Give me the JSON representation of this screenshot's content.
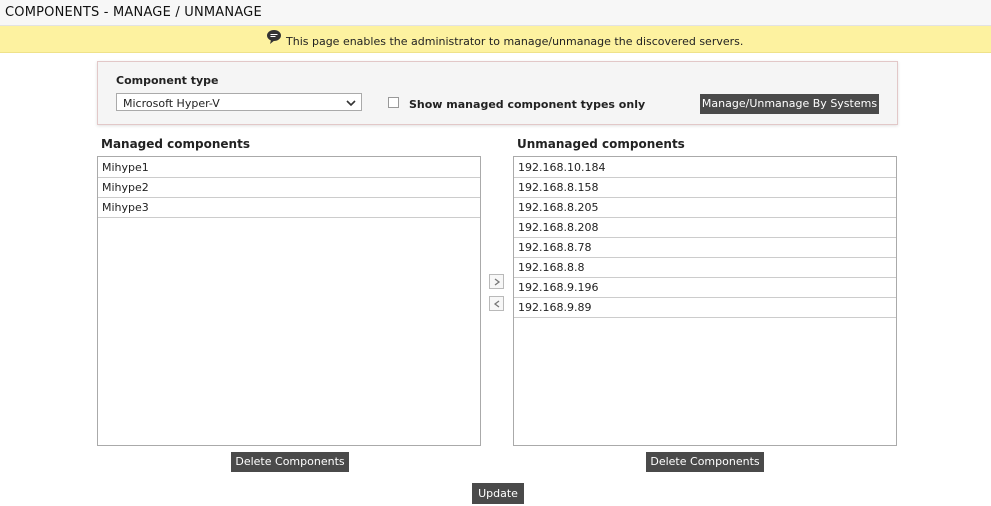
{
  "header": {
    "title": "COMPONENTS - MANAGE / UNMANAGE"
  },
  "info": {
    "icon": "speech-bubble-icon",
    "message": "This page enables the administrator to manage/unmanage the discovered servers."
  },
  "filter": {
    "component_type_label": "Component type",
    "component_type_value": "Microsoft Hyper-V",
    "checkbox_label": "Show managed component types only",
    "systems_button": "Manage/Unmanage By Systems"
  },
  "managed": {
    "heading": "Managed components",
    "items": [
      "Mihype1",
      "Mihype2",
      "Mihype3"
    ],
    "delete_button": "Delete Components"
  },
  "unmanaged": {
    "heading": "Unmanaged components",
    "items": [
      "192.168.10.184",
      "192.168.8.158",
      "192.168.8.205",
      "192.168.8.208",
      "192.168.8.78",
      "192.168.8.8",
      "192.168.9.196",
      "192.168.9.89"
    ],
    "delete_button": "Delete Components"
  },
  "actions": {
    "update_button": "Update"
  },
  "colors": {
    "info_bg": "#fdf2a0",
    "button_bg": "#4a4a4a"
  }
}
